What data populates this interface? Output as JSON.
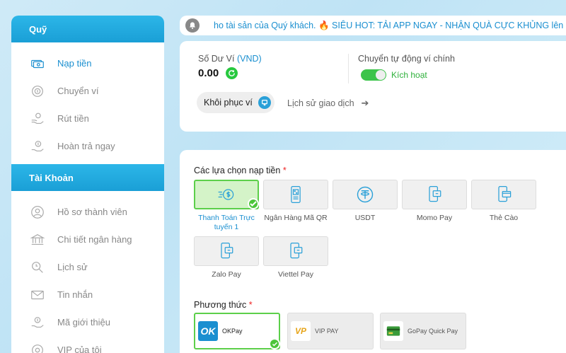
{
  "sidebar": {
    "section1_title": "Quỹ",
    "section1_items": [
      {
        "label": "Nạp tiền",
        "icon": "deposit-cash-icon",
        "active": true
      },
      {
        "label": "Chuyển ví",
        "icon": "transfer-icon",
        "active": false
      },
      {
        "label": "Rút tiền",
        "icon": "withdraw-icon",
        "active": false
      },
      {
        "label": "Hoàn trả ngay",
        "icon": "rebate-icon",
        "active": false
      }
    ],
    "section2_title": "Tài Khoản",
    "section2_items": [
      {
        "label": "Hồ sơ thành viên",
        "icon": "profile-icon"
      },
      {
        "label": "Chi tiết ngân hàng",
        "icon": "bank-icon"
      },
      {
        "label": "Lịch sử",
        "icon": "history-icon"
      },
      {
        "label": "Tin nhắn",
        "icon": "mail-icon"
      },
      {
        "label": "Mã giới thiệu",
        "icon": "referral-icon"
      },
      {
        "label": "VIP của tôi",
        "icon": "vip-icon"
      }
    ]
  },
  "marquee": {
    "text": "ho tài sản của Quý khách. 🔥 SIÊU HOT: TẢI APP NGAY - NHẬN QUÀ CỰC KHỦNG lên đến"
  },
  "wallet": {
    "balance_label": "Số Dư Ví",
    "currency": "(VND)",
    "balance_value": "0.00",
    "auto_transfer_label": "Chuyển tự động ví chính",
    "toggle_state": "Kích hoạt",
    "restore_button": "Khôi phục ví",
    "history_link": "Lịch sử giao dịch"
  },
  "deposit": {
    "options_title": "Các lựa chọn nạp tiền",
    "required_mark": "*",
    "options": [
      {
        "label": "Thanh Toán Trực tuyến 1",
        "icon": "online-payment-icon",
        "selected": true
      },
      {
        "label": "Ngân Hàng Mã QR",
        "icon": "qr-bank-icon",
        "selected": false
      },
      {
        "label": "USDT",
        "icon": "usdt-icon",
        "selected": false
      },
      {
        "label": "Momo Pay",
        "icon": "momo-phone-icon",
        "selected": false
      },
      {
        "label": "Thẻ Cào",
        "icon": "scratch-card-icon",
        "selected": false
      },
      {
        "label": "Zalo Pay",
        "icon": "zalo-phone-icon",
        "selected": false
      },
      {
        "label": "Viettel Pay",
        "icon": "viettel-phone-icon",
        "selected": false
      }
    ],
    "method_title": "Phương thức",
    "methods": [
      {
        "label": "OKPay",
        "logo": "OK",
        "selected": true
      },
      {
        "label": "VIP PAY",
        "logo": "VP",
        "selected": false
      },
      {
        "label": "GoPay Quick Pay",
        "logo": "",
        "selected": false
      }
    ]
  },
  "colors": {
    "accent": "#1a8fd0",
    "header_blue": "#2cb6e8",
    "success_green": "#4cc53a",
    "required_red": "#e22222"
  }
}
